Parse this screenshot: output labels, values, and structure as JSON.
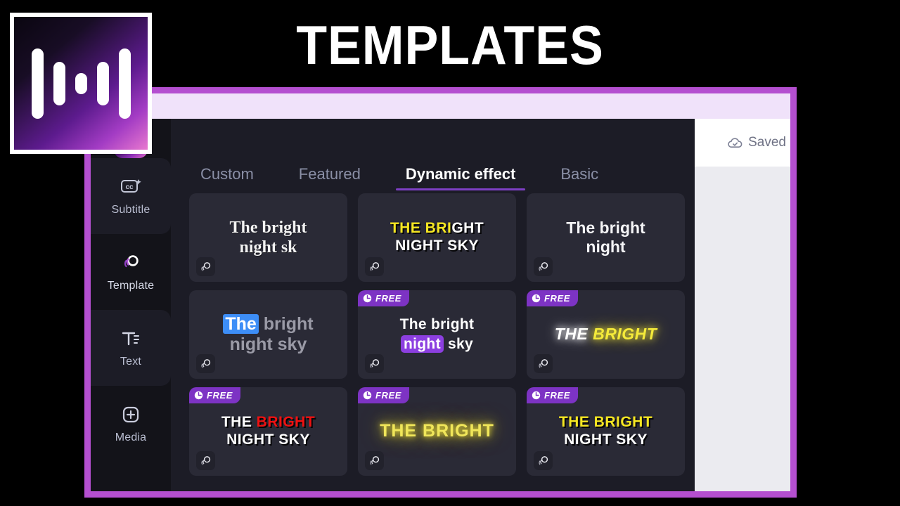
{
  "banner": {
    "title": "TEMPLATES"
  },
  "logo": {
    "name": "app-logo-waveform"
  },
  "sidebar": {
    "items": [
      {
        "label": "Subtitle",
        "icon": "closed-caption-icon",
        "active": false
      },
      {
        "label": "Template",
        "icon": "template-rings-icon",
        "active": true
      },
      {
        "label": "Text",
        "icon": "text-icon",
        "active": false
      },
      {
        "label": "Media",
        "icon": "add-media-icon",
        "active": false
      }
    ]
  },
  "tabs": [
    {
      "label": "Custom",
      "active": false
    },
    {
      "label": "Featured",
      "active": false
    },
    {
      "label": "Dynamic effect",
      "active": true
    },
    {
      "label": "Basic",
      "active": false
    }
  ],
  "templates": [
    {
      "id": "tpl-1",
      "style": "serif",
      "free": false,
      "lines": [
        [
          {
            "text": "The bright",
            "look": "serif"
          }
        ],
        [
          {
            "text": "night sk",
            "look": "serif"
          }
        ]
      ]
    },
    {
      "id": "tpl-2",
      "style": "bold-yellow-white",
      "free": false,
      "lines": [
        [
          {
            "text": "THE BRI",
            "look": "yellow"
          },
          {
            "text": "GHT",
            "look": "white"
          }
        ],
        [
          {
            "text": "NIGHT SKY",
            "look": "white"
          }
        ]
      ]
    },
    {
      "id": "tpl-3",
      "style": "plain-white",
      "free": false,
      "lines": [
        [
          {
            "text": "The bright",
            "look": "plain"
          }
        ],
        [
          {
            "text": "night",
            "look": "plain"
          }
        ]
      ]
    },
    {
      "id": "tpl-4",
      "style": "blue-highlight",
      "free": false,
      "lines": [
        [
          {
            "text": "The",
            "look": "hl-blue"
          },
          {
            "text": " bright",
            "look": "gray"
          }
        ],
        [
          {
            "text": "night sky",
            "look": "gray"
          }
        ]
      ]
    },
    {
      "id": "tpl-5",
      "style": "purple-highlight",
      "free": true,
      "lines": [
        [
          {
            "text": "The bright",
            "look": "white-bold"
          }
        ],
        [
          {
            "text": "night",
            "look": "hl-purple"
          },
          {
            "text": " sky",
            "look": "white-bold"
          }
        ]
      ]
    },
    {
      "id": "tpl-6",
      "style": "neon-italic",
      "free": true,
      "lines": [
        [
          {
            "text": "THE ",
            "look": "glow-white"
          },
          {
            "text": "BRIGHT",
            "look": "glow-yellow"
          }
        ]
      ]
    },
    {
      "id": "tpl-7",
      "style": "red-white-shadow",
      "free": true,
      "lines": [
        [
          {
            "text": "THE ",
            "look": "white"
          },
          {
            "text": "BRIGHT",
            "look": "red"
          }
        ],
        [
          {
            "text": "NIGHT SKY",
            "look": "white"
          }
        ]
      ]
    },
    {
      "id": "tpl-8",
      "style": "neon-outline",
      "free": true,
      "lines": [
        [
          {
            "text": "THE BRIGHT",
            "look": "neonline"
          }
        ]
      ]
    },
    {
      "id": "tpl-9",
      "style": "yellow-white-shadow",
      "free": true,
      "lines": [
        [
          {
            "text": "THE BRIGHT",
            "look": "yellow"
          }
        ],
        [
          {
            "text": "NIGHT SKY",
            "look": "white"
          }
        ]
      ]
    }
  ],
  "badges": {
    "free_label": "FREE"
  },
  "right_panel": {
    "saved_label": "Saved",
    "saved_icon": "cloud-check-icon"
  },
  "colors": {
    "frame_purple": "#b44fd0",
    "tab_active_underline": "#7d3fc4",
    "badge_purple": "#7d33c4",
    "card_bg": "#2a2a36",
    "panel_bg": "#1c1c26",
    "rail_bg": "#131319",
    "right_panel_bg": "#ebebf0",
    "topbar_lavender": "#f0e2fa",
    "accent_yellow": "#f5e622",
    "accent_red": "#ef1111",
    "accent_blue": "#3d8ef7"
  }
}
